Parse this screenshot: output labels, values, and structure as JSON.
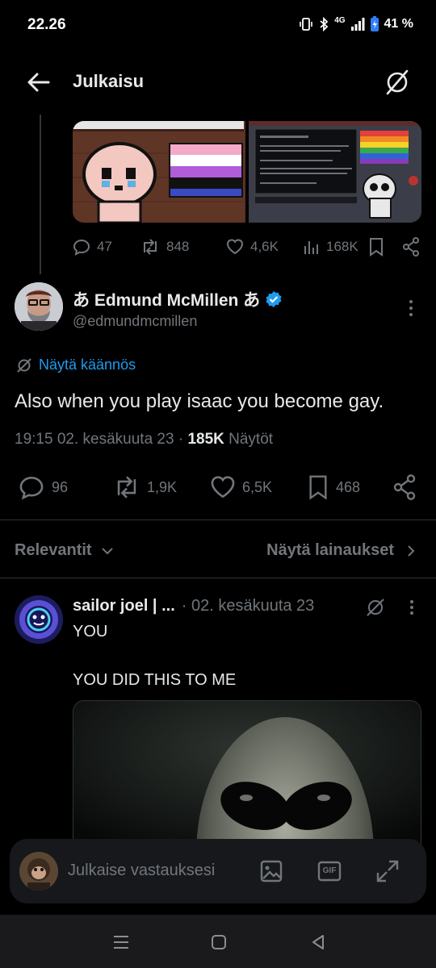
{
  "status": {
    "time": "22.26",
    "network": "4G",
    "battery": "41 %"
  },
  "header": {
    "title": "Julkaisu",
    "back_icon": "arrow-left-icon",
    "action_icon": "translate-off-icon"
  },
  "quoted": {
    "stats": {
      "replies": "47",
      "reposts": "848",
      "likes": "4,6K",
      "views": "168K"
    }
  },
  "tweet": {
    "author_name": "あ Edmund McMillen あ",
    "author_handle": "@edmundmcmillen",
    "verified": true,
    "translate_label": "Näytä käännös",
    "text": "Also when you play isaac you become gay.",
    "time_date": "19:15 02. kesäkuuta 23 ·",
    "views_count": "185K",
    "views_label": "Näytöt",
    "stats": {
      "replies": "96",
      "reposts": "1,9K",
      "likes": "6,5K",
      "bookmarks": "468"
    }
  },
  "sort": {
    "relevance_label": "Relevantit",
    "quotes_label": "Näytä lainaukset"
  },
  "reply": {
    "name": "sailor joel | ...",
    "date": "· 02. kesäkuuta 23",
    "line1": "YOU",
    "line2": "YOU DID THIS TO ME"
  },
  "compose": {
    "placeholder": "Julkaise vastauksesi",
    "gif_label": "GIF"
  },
  "colors": {
    "accent": "#1d9bf0",
    "muted": "#71767b",
    "text": "#e7e9ea",
    "background": "#000000"
  }
}
